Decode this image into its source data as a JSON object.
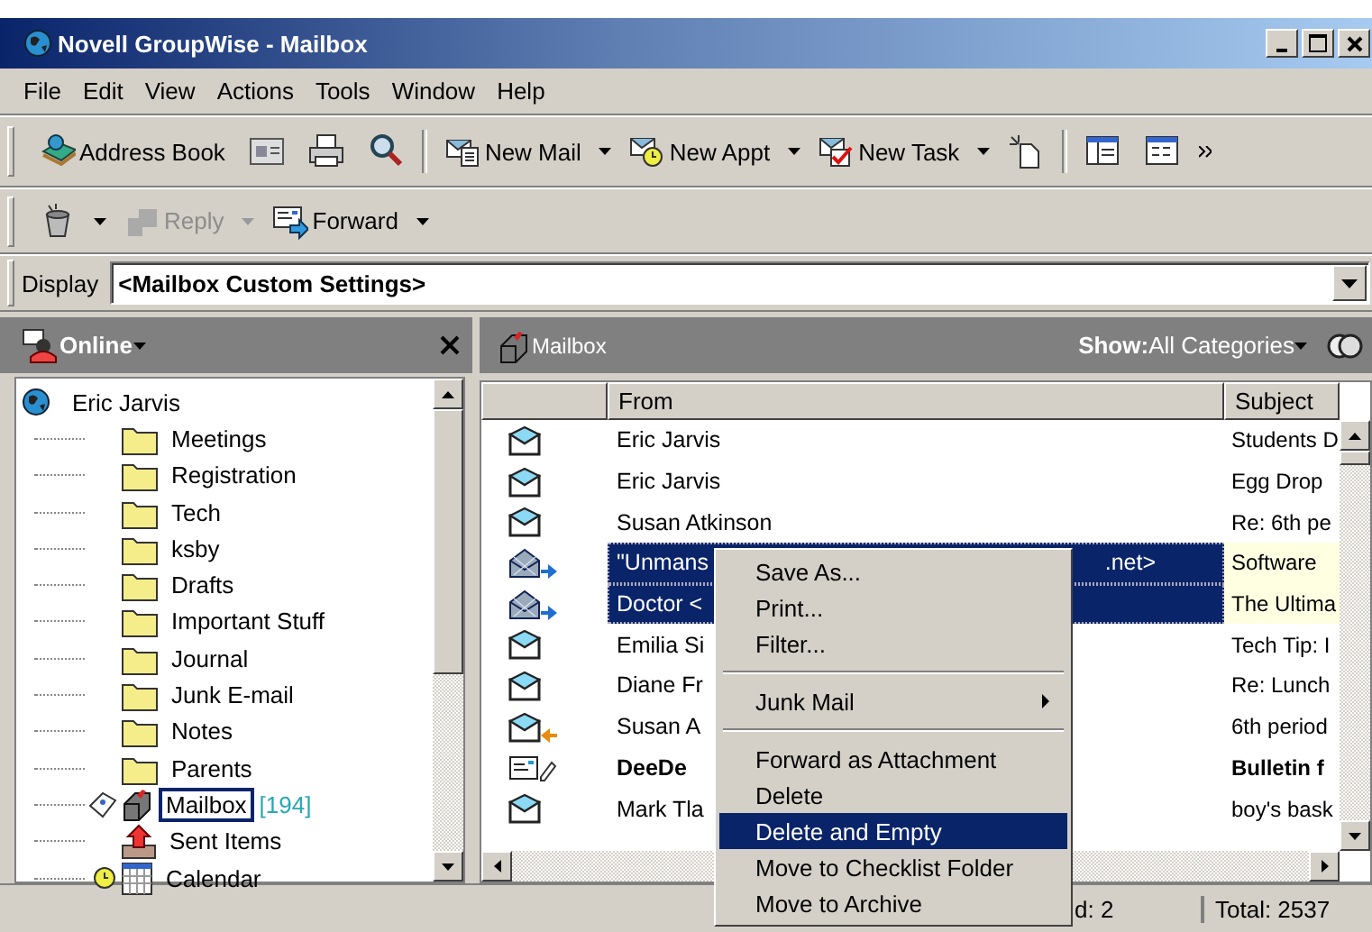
{
  "window": {
    "title": "Novell GroupWise - Mailbox"
  },
  "menu": [
    "File",
    "Edit",
    "View",
    "Actions",
    "Tools",
    "Window",
    "Help"
  ],
  "toolbar": {
    "address_book": "Address Book",
    "new_mail": "New Mail",
    "new_appt": "New Appt",
    "new_task": "New Task"
  },
  "toolbar_2": {
    "reply": {
      "label": "Reply",
      "disabled": true
    },
    "forward": {
      "label": "Forward",
      "disabled": false
    }
  },
  "display": {
    "label": "Display",
    "value": "<Mailbox Custom Settings>"
  },
  "folders": {
    "title": "Online",
    "root": {
      "label": "Eric Jarvis",
      "children": [
        {
          "kind": "folder",
          "label": "Meetings",
          "selected": false
        },
        {
          "kind": "folder",
          "label": "Registration",
          "selected": false
        },
        {
          "kind": "folder",
          "label": "Tech",
          "selected": false
        },
        {
          "kind": "folder",
          "label": "ksby",
          "selected": false
        },
        {
          "kind": "folder",
          "label": "Drafts",
          "selected": false
        },
        {
          "kind": "folder",
          "label": "Important Stuff",
          "selected": false
        },
        {
          "kind": "folder",
          "label": "Journal",
          "selected": false
        },
        {
          "kind": "folder",
          "label": "Junk E-mail",
          "selected": false
        },
        {
          "kind": "folder",
          "label": "Notes",
          "selected": false
        },
        {
          "kind": "folder",
          "label": "Parents",
          "selected": false
        },
        {
          "kind": "mailbox",
          "label": "Mailbox",
          "count": "[194]",
          "selected": true
        },
        {
          "kind": "sent",
          "label": "Sent Items",
          "selected": false
        },
        {
          "kind": "calendar",
          "label": "Calendar",
          "selected": false
        }
      ]
    }
  },
  "mail": {
    "title": "Mailbox",
    "show_label": "Show:",
    "show_value": "All Categories",
    "columns": [
      "From",
      "Subject"
    ],
    "rows": [
      {
        "kind": "read",
        "from": "Eric Jarvis",
        "subject": "Students D",
        "unread": false,
        "selected": false
      },
      {
        "kind": "read",
        "from": "Eric Jarvis",
        "subject": "Egg Drop",
        "unread": false,
        "selected": false
      },
      {
        "kind": "read",
        "from": "Susan Atkinson",
        "subject": "Re: 6th pe",
        "unread": false,
        "selected": false
      },
      {
        "kind": "forwarded",
        "from": "\"Unmans",
        "from_end": ".net>",
        "subject": "Software",
        "unread": false,
        "selected": true
      },
      {
        "kind": "forwarded",
        "from": "Doctor <",
        "subject": "The Ultima",
        "unread": false,
        "selected": true
      },
      {
        "kind": "read",
        "from": "Emilia Si",
        "subject": "Tech Tip: I",
        "unread": false,
        "selected": false
      },
      {
        "kind": "read",
        "from": "Diane Fr",
        "subject": "Re: Lunch",
        "unread": false,
        "selected": false
      },
      {
        "kind": "replied",
        "from": "Susan A",
        "subject": "6th period",
        "unread": false,
        "selected": false
      },
      {
        "kind": "note",
        "from": "DeeDe",
        "subject": "Bulletin f",
        "unread": true,
        "selected": false
      },
      {
        "kind": "read",
        "from": "Mark Tla",
        "subject": "boy's bask",
        "unread": false,
        "selected": false
      }
    ]
  },
  "context_menu": [
    {
      "kind": "item",
      "label": "Save As...",
      "selected": false
    },
    {
      "kind": "item",
      "label": "Print...",
      "selected": false
    },
    {
      "kind": "item",
      "label": "Filter...",
      "selected": false
    },
    {
      "kind": "separator"
    },
    {
      "kind": "submenu",
      "label": "Junk Mail",
      "selected": false
    },
    {
      "kind": "separator"
    },
    {
      "kind": "item",
      "label": "Forward as Attachment",
      "selected": false
    },
    {
      "kind": "item",
      "label": "Delete",
      "selected": false
    },
    {
      "kind": "item",
      "label": "Delete and Empty",
      "selected": true
    },
    {
      "kind": "item",
      "label": "Move to Checklist Folder",
      "selected": false
    },
    {
      "kind": "item",
      "label": "Move to Archive",
      "selected": false
    }
  ],
  "status_bar": {
    "field_1": "d: 2",
    "total": "Total: 2537"
  }
}
